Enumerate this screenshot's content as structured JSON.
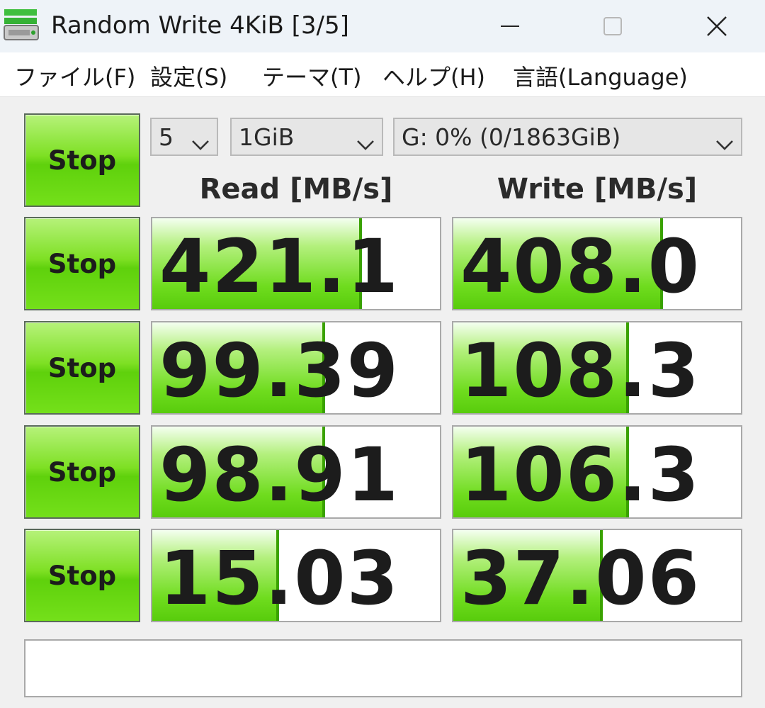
{
  "window": {
    "title": "Random Write 4KiB [3/5]",
    "icons": [
      "app-drive-icon",
      "minimize-icon",
      "maximize-icon",
      "close-icon"
    ]
  },
  "menu": {
    "file": "ファイル(F)",
    "settings": "設定(S)",
    "theme": "テーマ(T)",
    "help": "ヘルプ(H)",
    "language": "言語(Language)"
  },
  "controls": {
    "count": "5",
    "size": "1GiB",
    "drive": "G: 0% (0/1863GiB)"
  },
  "headers": {
    "read": "Read [MB/s]",
    "write": "Write [MB/s]"
  },
  "all_button": "Stop",
  "rows": [
    {
      "button": "Stop",
      "read": "421.1",
      "write": "408.0",
      "read_fill": 0.72,
      "write_fill": 0.72
    },
    {
      "button": "Stop",
      "read": "99.39",
      "write": "108.3",
      "read_fill": 0.59,
      "write_fill": 0.6
    },
    {
      "button": "Stop",
      "read": "98.91",
      "write": "106.3",
      "read_fill": 0.59,
      "write_fill": 0.6
    },
    {
      "button": "Stop",
      "read": "15.03",
      "write": "37.06",
      "read_fill": 0.43,
      "write_fill": 0.51
    }
  ],
  "comment": "",
  "colors": {
    "button_green": "#6fdc1e",
    "bar_green": "#58cc0c",
    "titlebar": "#eef3f8"
  }
}
